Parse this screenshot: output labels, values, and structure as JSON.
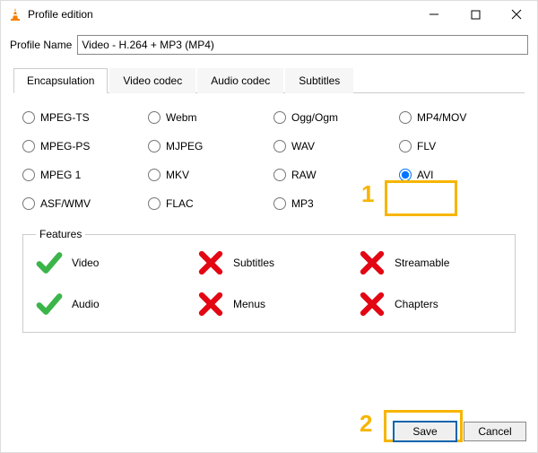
{
  "window": {
    "title": "Profile edition"
  },
  "profile": {
    "label": "Profile Name",
    "value": "Video - H.264 + MP3 (MP4)"
  },
  "tabs": {
    "encapsulation": "Encapsulation",
    "video": "Video codec",
    "audio": "Audio codec",
    "subtitles": "Subtitles"
  },
  "radios": {
    "mpegts": "MPEG-TS",
    "webm": "Webm",
    "oggogm": "Ogg/Ogm",
    "mp4mov": "MP4/MOV",
    "mpegps": "MPEG-PS",
    "mjpeg": "MJPEG",
    "wav": "WAV",
    "flv": "FLV",
    "mpeg1": "MPEG 1",
    "mkv": "MKV",
    "raw": "RAW",
    "avi": "AVI",
    "asfwmv": "ASF/WMV",
    "flac": "FLAC",
    "mp3": "MP3"
  },
  "features": {
    "legend": "Features",
    "video": "Video",
    "subtitles": "Subtitles",
    "streamable": "Streamable",
    "audio": "Audio",
    "menus": "Menus",
    "chapters": "Chapters"
  },
  "buttons": {
    "save": "Save",
    "cancel": "Cancel"
  },
  "annotations": {
    "one": "1",
    "two": "2"
  }
}
